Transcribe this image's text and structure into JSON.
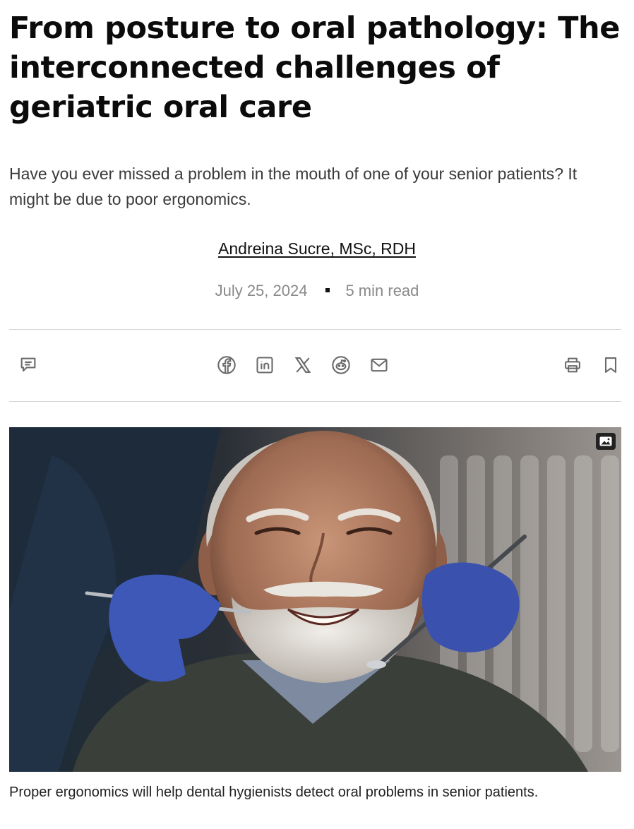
{
  "article": {
    "headline": "From posture to oral pathology: The interconnected challenges of geriatric oral care",
    "dek": "Have you ever missed a problem in the mouth of one of your senior patients? It might be due to poor ergonomics.",
    "author": "Andreina Sucre, MSc, RDH",
    "date": "July 25, 2024",
    "read_time": "5 min read"
  },
  "toolbar": {
    "icons": [
      "comment-icon",
      "facebook-icon",
      "linkedin-icon",
      "x-icon",
      "reddit-icon",
      "email-icon",
      "print-icon",
      "bookmark-icon"
    ]
  },
  "hero": {
    "image_subject": "smiling senior man with white beard receiving dental exam, gloved hands holding dental instruments",
    "badge_icon": "image-gallery-icon",
    "caption": "Proper ergonomics will help dental hygienists detect oral problems in senior patients."
  },
  "colors": {
    "text": "#0b0b0b",
    "muted": "#8a8a8a",
    "rule": "#d4d4d4",
    "icon": "#6b6b6b",
    "glove": "#3e58b8"
  }
}
